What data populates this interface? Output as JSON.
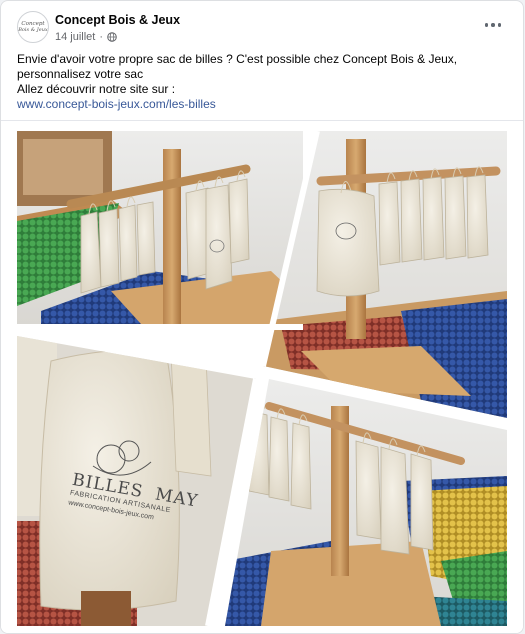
{
  "post": {
    "page_name": "Concept Bois & Jeux",
    "date": "14 juillet",
    "avatar_line1": "Concept",
    "avatar_line2": "Bois & Jeux",
    "text_lines": [
      "Envie d'avoir votre propre sac de billes ? C'est possible chez Concept Bois & Jeux,",
      "personnalisez votre sac",
      "Allez découvrir notre site sur :"
    ],
    "link": "www.concept-bois-jeux.com/les-billes"
  },
  "icons": {
    "privacy": "globe-icon",
    "more": "more-options-icon"
  },
  "photo": {
    "bag_brand": "BILLES",
    "bag_brand2": "MAY",
    "bag_tagline": "FABRICATION ARTISANALE",
    "bag_url": "www.concept-bois-jeux.com"
  },
  "colors": {
    "link": "#385898",
    "secondary_text": "#65676b",
    "bag_canvas": "#e9e3d3",
    "wood": "#c99a63",
    "marble_green": "#3f9a4a",
    "marble_blue": "#2f4f9c",
    "marble_red": "#a8473a",
    "marble_yellow": "#d9b53a"
  }
}
